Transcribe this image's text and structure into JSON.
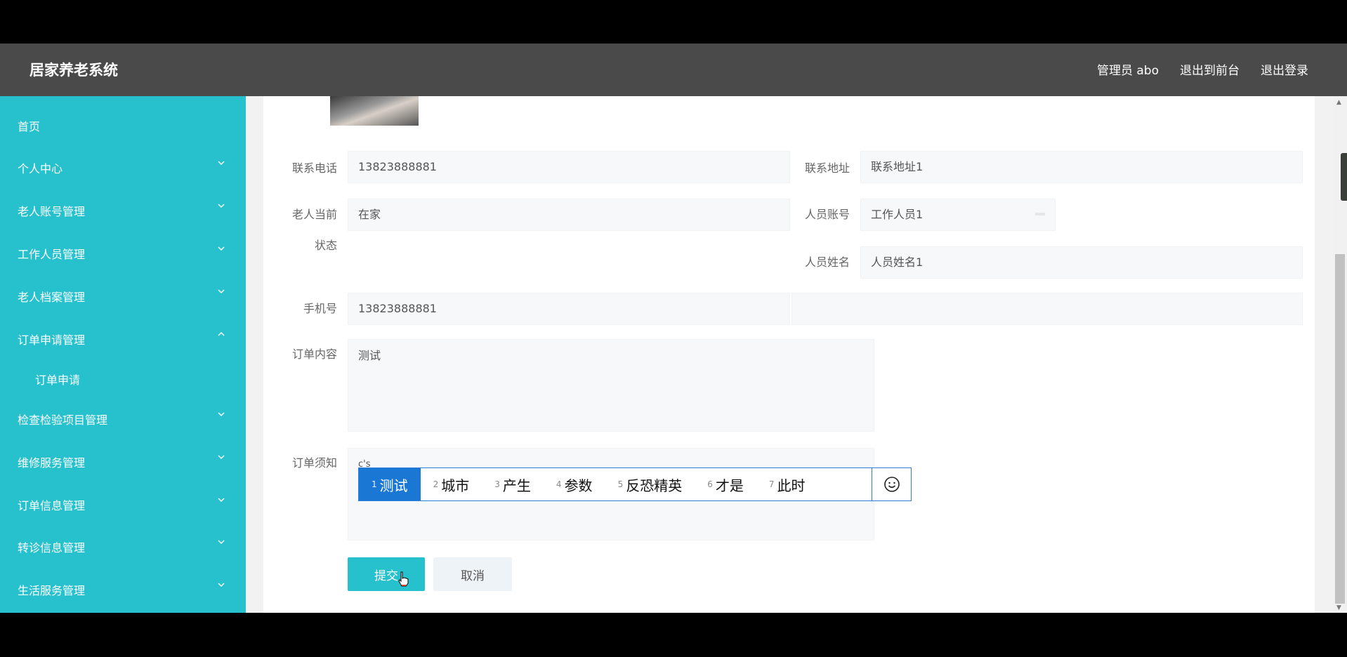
{
  "app": {
    "title": "居家养老系统"
  },
  "header": {
    "user_label": "管理员 abo",
    "front_label": "退出到前台",
    "logout_label": "退出登录"
  },
  "sidebar": {
    "items": [
      {
        "label": "首页",
        "icon": "none"
      },
      {
        "label": "个人中心",
        "icon": "chevron-down-icon"
      },
      {
        "label": "老人账号管理",
        "icon": "chevron-down-icon"
      },
      {
        "label": "工作人员管理",
        "icon": "chevron-down-icon"
      },
      {
        "label": "老人档案管理",
        "icon": "chevron-down-icon"
      },
      {
        "label": "订单申请管理",
        "icon": "chevron-up-icon"
      },
      {
        "label": "订单申请",
        "icon": "none"
      },
      {
        "label": "检查检验项目管理",
        "icon": "chevron-down-icon"
      },
      {
        "label": "维修服务管理",
        "icon": "chevron-down-icon"
      },
      {
        "label": "订单信息管理",
        "icon": "chevron-down-icon"
      },
      {
        "label": "转诊信息管理",
        "icon": "chevron-down-icon"
      },
      {
        "label": "生活服务管理",
        "icon": "chevron-down-icon"
      }
    ]
  },
  "form": {
    "phone": {
      "label": "联系电话",
      "value": "13823888881"
    },
    "address": {
      "label": "联系地址",
      "value": "联系地址1"
    },
    "status": {
      "label_line1": "老人当前",
      "label_line2": "状态",
      "value": "在家"
    },
    "staff_account": {
      "label": "人员账号",
      "value": "工作人员1"
    },
    "staff_name": {
      "label": "人员姓名",
      "value": "人员姓名1"
    },
    "mobile": {
      "label": "手机号",
      "value": "13823888881"
    },
    "order_content": {
      "label": "订单内容",
      "value": "测试"
    },
    "order_notice": {
      "label": "订单须知",
      "value": "c's"
    }
  },
  "ime": {
    "candidates": [
      {
        "num": "1",
        "text": "测试"
      },
      {
        "num": "2",
        "text": "城市"
      },
      {
        "num": "3",
        "text": "产生"
      },
      {
        "num": "4",
        "text": "参数"
      },
      {
        "num": "5",
        "text": "反恐精英"
      },
      {
        "num": "6",
        "text": "才是"
      },
      {
        "num": "7",
        "text": "此时"
      }
    ],
    "emoji_icon": "smiley-icon",
    "accent": "#1a78d4"
  },
  "buttons": {
    "submit": "提交",
    "cancel": "取消"
  },
  "colors": {
    "sidebar": "#27c1ce",
    "header": "#4a4a4a",
    "primary": "#27c1ce"
  }
}
